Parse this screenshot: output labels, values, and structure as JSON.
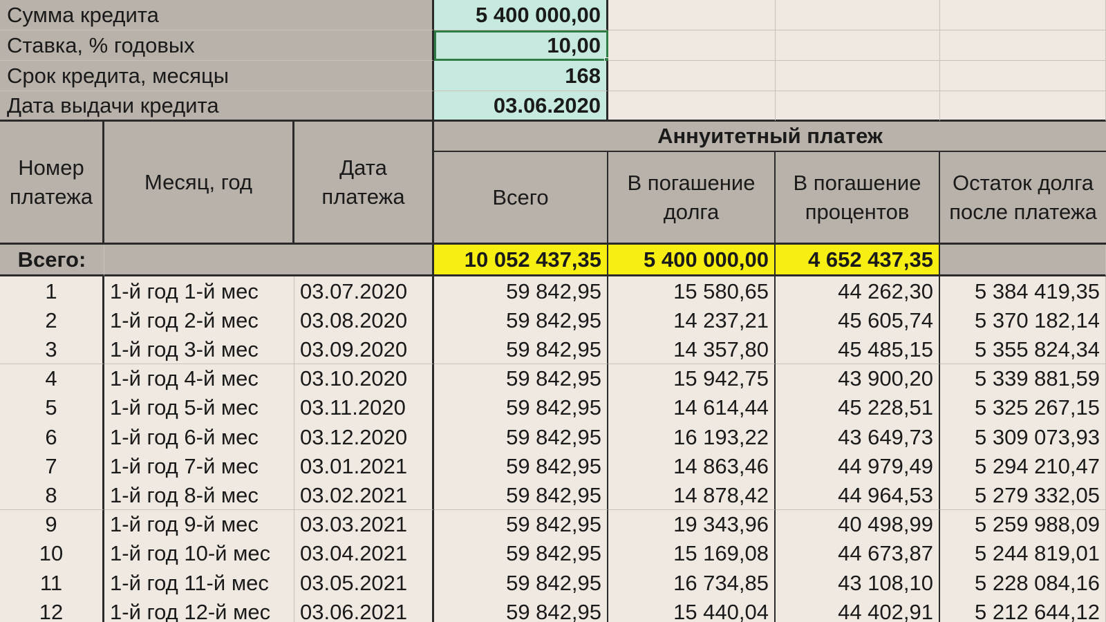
{
  "params": [
    {
      "label": "Сумма кредита",
      "value": "5 400 000,00"
    },
    {
      "label": "Ставка, % годовых",
      "value": "10,00"
    },
    {
      "label": "Срок кредита, месяцы",
      "value": "168"
    },
    {
      "label": "Дата выдачи кредита",
      "value": "03.06.2020"
    }
  ],
  "headers": {
    "number": "Номер платежа",
    "month_year": "Месяц, год",
    "date": "Дата платежа",
    "group": "Аннуитетный платеж",
    "total": "Всего",
    "principal": "В погашение долга",
    "interest": "В погашение процентов",
    "balance": "Остаток долга после платежа"
  },
  "totals": {
    "label": "Всего:",
    "total": "10 052 437,35",
    "principal": "5 400 000,00",
    "interest": "4 652 437,35"
  },
  "rows": [
    {
      "n": "1",
      "month": "1-й год 1-й мес",
      "date": "03.07.2020",
      "total": "59 842,95",
      "principal": "15 580,65",
      "interest": "44 262,30",
      "balance": "5 384 419,35"
    },
    {
      "n": "2",
      "month": "1-й год 2-й мес",
      "date": "03.08.2020",
      "total": "59 842,95",
      "principal": "14 237,21",
      "interest": "45 605,74",
      "balance": "5 370 182,14"
    },
    {
      "n": "3",
      "month": "1-й год 3-й мес",
      "date": "03.09.2020",
      "total": "59 842,95",
      "principal": "14 357,80",
      "interest": "45 485,15",
      "balance": "5 355 824,34"
    },
    {
      "n": "4",
      "month": "1-й год 4-й мес",
      "date": "03.10.2020",
      "total": "59 842,95",
      "principal": "15 942,75",
      "interest": "43 900,20",
      "balance": "5 339 881,59"
    },
    {
      "n": "5",
      "month": "1-й год 5-й мес",
      "date": "03.11.2020",
      "total": "59 842,95",
      "principal": "14 614,44",
      "interest": "45 228,51",
      "balance": "5 325 267,15"
    },
    {
      "n": "6",
      "month": "1-й год 6-й мес",
      "date": "03.12.2020",
      "total": "59 842,95",
      "principal": "16 193,22",
      "interest": "43 649,73",
      "balance": "5 309 073,93"
    },
    {
      "n": "7",
      "month": "1-й год 7-й мес",
      "date": "03.01.2021",
      "total": "59 842,95",
      "principal": "14 863,46",
      "interest": "44 979,49",
      "balance": "5 294 210,47"
    },
    {
      "n": "8",
      "month": "1-й год 8-й мес",
      "date": "03.02.2021",
      "total": "59 842,95",
      "principal": "14 878,42",
      "interest": "44 964,53",
      "balance": "5 279 332,05"
    },
    {
      "n": "9",
      "month": "1-й год 9-й мес",
      "date": "03.03.2021",
      "total": "59 842,95",
      "principal": "19 343,96",
      "interest": "40 498,99",
      "balance": "5 259 988,09"
    },
    {
      "n": "10",
      "month": "1-й год 10-й мес",
      "date": "03.04.2021",
      "total": "59 842,95",
      "principal": "15 169,08",
      "interest": "44 673,87",
      "balance": "5 244 819,01"
    },
    {
      "n": "11",
      "month": "1-й год 11-й мес",
      "date": "03.05.2021",
      "total": "59 842,95",
      "principal": "16 734,85",
      "interest": "43 108,10",
      "balance": "5 228 084,16"
    },
    {
      "n": "12",
      "month": "1-й год 12-й мес",
      "date": "03.06.2021",
      "total": "59 842,95",
      "principal": "15 440,04",
      "interest": "44 402,91",
      "balance": "5 212 644,12"
    }
  ],
  "colors": {
    "input_fill": "#c6eadf",
    "header_fill": "#b8b2aa",
    "total_highlight": "#f7ef12",
    "selection_border": "#2f7d44",
    "sheet_background": "#efe9e1"
  }
}
